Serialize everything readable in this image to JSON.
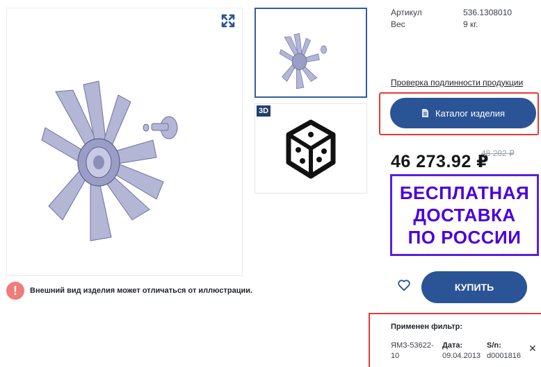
{
  "product": {
    "notice": "Внешний вид изделия может отличаться от иллюстрации.",
    "thumb_3d_badge": "3D"
  },
  "specs": [
    {
      "label": "Артикул",
      "value": "536.1308010"
    },
    {
      "label": "Вес",
      "value": "9 кг."
    }
  ],
  "verify_link": "Проверка подлинности продукции",
  "catalog_button": "Каталог изделия",
  "price": {
    "current": "46 273.92 ₽",
    "old": "48 202 ₽"
  },
  "delivery": {
    "line1": "БЕСПЛАТНАЯ",
    "line2": "ДОСТАВКА",
    "line3": "ПО РОССИИ"
  },
  "buy_button": "КУПИТЬ",
  "filter": {
    "title": "Применен фильтр:",
    "model": "ЯМЗ-53622-10",
    "date_label": "Дата:",
    "date_value": "09.04.2013",
    "sn_label": "S/n:",
    "sn_value": "d0001816"
  },
  "colors": {
    "primary": "#2a5496",
    "highlight": "#e53935",
    "delivery": "#4b00e0",
    "notice": "#ef7b7b"
  },
  "icons": [
    "expand-icon",
    "cube-3d-icon",
    "document-icon",
    "heart-icon",
    "close-icon",
    "alert-icon"
  ]
}
